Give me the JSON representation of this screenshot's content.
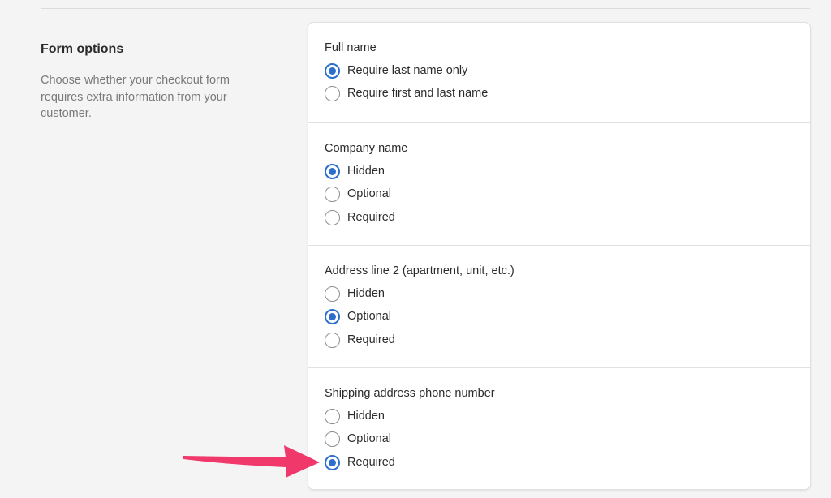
{
  "section": {
    "title": "Form options",
    "description": "Choose whether your checkout form requires extra information from your customer."
  },
  "groups": [
    {
      "label": "Full name",
      "options": [
        "Require last name only",
        "Require first and last name"
      ],
      "selected": "Require last name only"
    },
    {
      "label": "Company name",
      "options": [
        "Hidden",
        "Optional",
        "Required"
      ],
      "selected": "Hidden"
    },
    {
      "label": "Address line 2 (apartment, unit, etc.)",
      "options": [
        "Hidden",
        "Optional",
        "Required"
      ],
      "selected": "Optional"
    },
    {
      "label": "Shipping address phone number",
      "options": [
        "Hidden",
        "Optional",
        "Required"
      ],
      "selected": "Required"
    }
  ],
  "colors": {
    "accent": "#2c6ecb",
    "annotation_arrow": "#f0386b"
  },
  "icons": {
    "annotation": "pointer-arrow-icon"
  }
}
